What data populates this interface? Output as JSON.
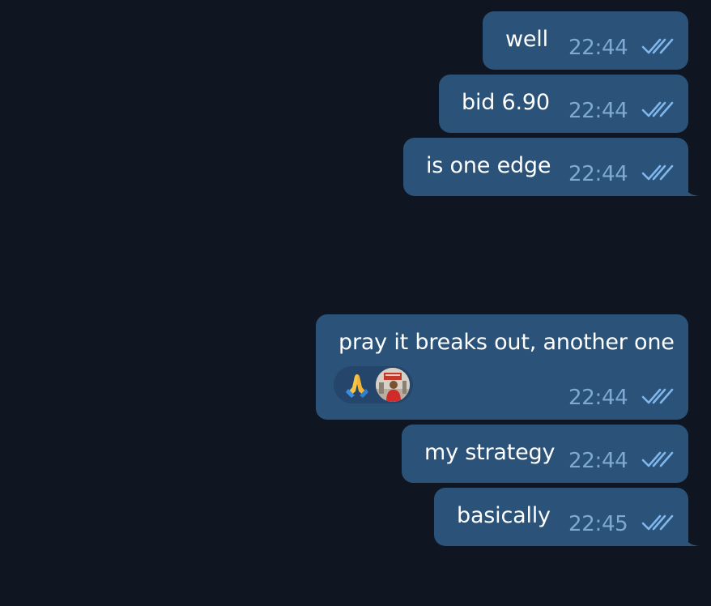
{
  "messages": [
    {
      "text": "well",
      "time": "22:44",
      "status_icon": "double-check-icon"
    },
    {
      "text": "bid 6.90",
      "time": "22:44",
      "status_icon": "double-check-icon"
    },
    {
      "text": "is one edge",
      "time": "22:44",
      "status_icon": "double-check-icon"
    },
    {
      "text": "pray it breaks out, another one",
      "time": "22:44",
      "status_icon": "double-check-icon",
      "reaction": {
        "emoji_icon": "folded-hands-icon",
        "reactor": "avatar"
      }
    },
    {
      "text": "my strategy",
      "time": "22:44",
      "status_icon": "double-check-icon"
    },
    {
      "text": "basically",
      "time": "22:45",
      "status_icon": "double-check-icon"
    }
  ],
  "colors": {
    "background": "#0f1621",
    "bubble_outgoing": "#2b5278",
    "time_text": "#7fa8d3",
    "check_marks": "#7fb6ec"
  }
}
